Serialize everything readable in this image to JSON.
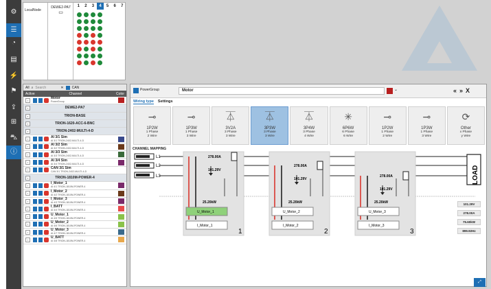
{
  "top": {
    "node_name": "LocalNode",
    "device_name": "DEWE2-PA7",
    "slots": [
      "1",
      "2",
      "3",
      "4",
      "5",
      "6",
      "7"
    ],
    "selected_slot": "4"
  },
  "channels": {
    "toolbar": {
      "filter": "All",
      "search_placeholder": "Search",
      "can_label": "CAN"
    },
    "header": {
      "active": "Active",
      "channel": "Channel",
      "color": "Color"
    },
    "rows": [
      {
        "type": "channel",
        "name": "Motor",
        "sub": "PowerGroup",
        "color": "#b82020"
      },
      {
        "type": "device",
        "name": "DEWE2-PA7"
      },
      {
        "type": "device",
        "name": "TRION-BASE"
      },
      {
        "type": "device",
        "name": "TRION-1620-ACC-6-BNC"
      },
      {
        "type": "device",
        "name": "TRION-2402-MULTI-4-D"
      },
      {
        "type": "channel",
        "name": "AI 3/1 Sim",
        "sub": "AI 3/1 TRION-2402-MULTI-4-D",
        "color": "#3a4a8c"
      },
      {
        "type": "channel",
        "name": "AI 3/2 Sim",
        "sub": "AI 3/2 TRION-2402-MULTI-4-D",
        "color": "#6b3a1a"
      },
      {
        "type": "channel",
        "name": "AI 3/3 Sim",
        "sub": "AI 3/3 TRION-2402-MULTI-4-D",
        "color": "#3a6a3a"
      },
      {
        "type": "channel",
        "name": "AI 3/4 Sim",
        "sub": "AI 3/4 TRION-2402-MULTI-4-D",
        "color": "#7a2a6a"
      },
      {
        "type": "channel",
        "name": "CAN 3/1 Sim",
        "sub": "CAN 3/1 TRION-2402-MULTI-4-D",
        "color": ""
      },
      {
        "type": "device",
        "name": "TRION-1810M-POWER-4"
      },
      {
        "type": "channel",
        "name": "I_Motor_1",
        "sub": "AI 4/1 TRION-1810M-POWER-4",
        "color": "#7a2a6a"
      },
      {
        "type": "channel",
        "name": "I_Motor_2",
        "sub": "AI 4/2 TRION-1810M-POWER-4",
        "color": "#6b3a1a"
      },
      {
        "type": "channel",
        "name": "I_Motor_3",
        "sub": "AI 4/3 TRION-1810M-POWER-4",
        "color": "#7a2a6a"
      },
      {
        "type": "channel",
        "name": "I_BATT",
        "sub": "AI 4/4 TRION-1810M-POWER-4",
        "color": "#e84c4c"
      },
      {
        "type": "channel",
        "name": "U_Motor_1",
        "sub": "AI 4/5 TRION-1810M-POWER-4",
        "color": "#8ac24a"
      },
      {
        "type": "channel",
        "name": "U_Motor_2",
        "sub": "AI 4/6 TRION-1810M-POWER-4",
        "color": "#8ac24a"
      },
      {
        "type": "channel",
        "name": "U_Motor_3",
        "sub": "AI 4/7 TRION-1810M-POWER-4",
        "color": "#3a6a8c"
      },
      {
        "type": "channel",
        "name": "U_BATT",
        "sub": "AI 4/8 TRION-1810M-POWER-4",
        "color": "#e8a84c"
      }
    ]
  },
  "power": {
    "group_label": "PowerGroup",
    "group_name": "Motor",
    "group_color": "#b82020",
    "nav": {
      "prev": "«",
      "next": "»",
      "close": "X"
    },
    "tabs": [
      "Wiring type",
      "Settings"
    ],
    "selected_tab": "Wiring type",
    "wiring_types": [
      {
        "code": "1P2W",
        "phase": "1 Phase",
        "wire": "2 Wire",
        "icon": "⊸"
      },
      {
        "code": "1P3W",
        "phase": "1 Phase",
        "wire": "3 Wire",
        "icon": "⊸"
      },
      {
        "code": "3V2A",
        "phase": "3 Phase",
        "wire": "3 Wire",
        "icon": "⏄"
      },
      {
        "code": "3P3W",
        "phase": "3 Phase",
        "wire": "3 Wire",
        "icon": "⏄"
      },
      {
        "code": "3P4W",
        "phase": "3 Phase",
        "wire": "4 Wire",
        "icon": "⏄"
      },
      {
        "code": "6P6W",
        "phase": "6 Phase",
        "wire": "6 Wire",
        "icon": "✳"
      },
      {
        "code": "1P2W",
        "phase": "1 Phase",
        "wire": "2 Wire",
        "icon": "⊸"
      },
      {
        "code": "1P3W",
        "phase": "1 Phase",
        "wire": "3 Wire",
        "icon": "⊸"
      },
      {
        "code": "Other",
        "phase": "x Phase",
        "wire": "y Wire",
        "icon": "⟳"
      }
    ],
    "selected_type_index": 3,
    "channel_mapping_label": "CHANNEL MAPPING",
    "lines": [
      "L1",
      "L2",
      "L3"
    ],
    "load_label": "LOAD",
    "phases": [
      {
        "num": "1",
        "current": "278.00A",
        "voltage": "101.29V",
        "power": "25.20kW",
        "current_ch": "I_Motor_1",
        "voltage_ch": "U_Motor_1"
      },
      {
        "num": "2",
        "current": "278.00A",
        "voltage": "101.29V",
        "power": "25.20kW",
        "current_ch": "I_Motor_2",
        "voltage_ch": "U_Motor_2"
      },
      {
        "num": "3",
        "current": "278.00A",
        "voltage": "101.29V",
        "power": "25.20kW",
        "current_ch": "I_Motor_3",
        "voltage_ch": "U_Motor_3"
      }
    ],
    "readouts": [
      "101.29V",
      "278.00A",
      "75.60kW",
      "899.92Hz"
    ]
  },
  "colors": {
    "accent": "#1e6fb4",
    "selected_card": "#9ec1e2",
    "voltage_wire": "#d9362d",
    "current_wire": "#222222"
  }
}
